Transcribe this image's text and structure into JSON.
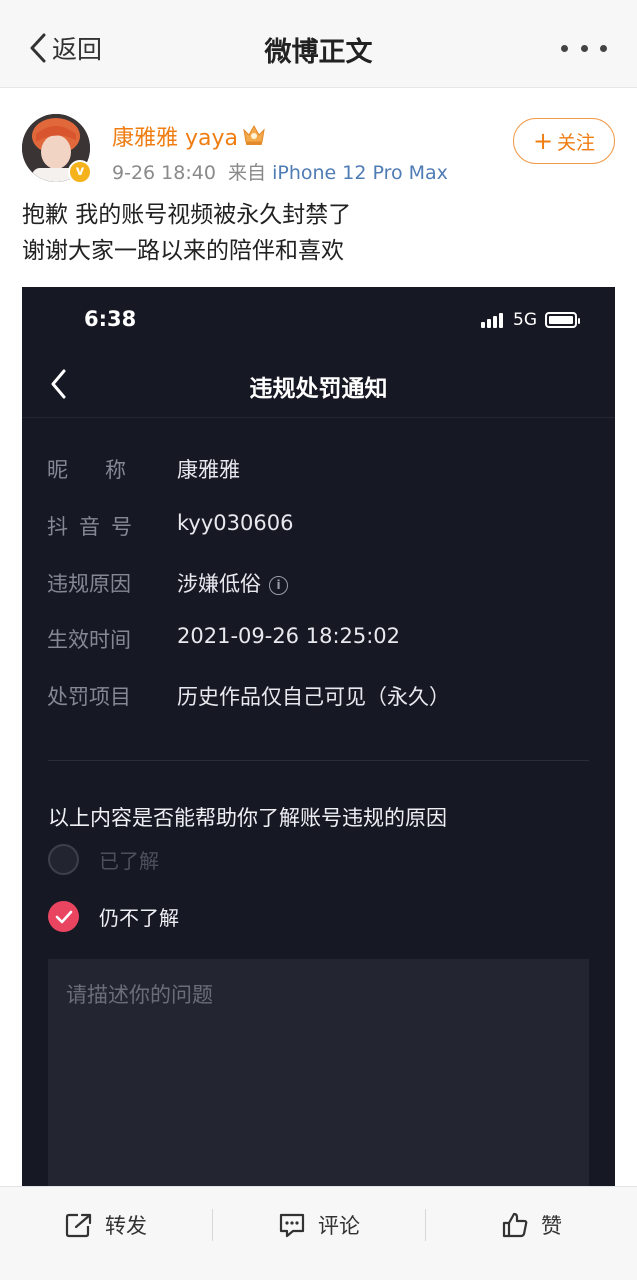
{
  "nav": {
    "back_label": "返回",
    "title": "微博正文"
  },
  "post": {
    "author": "康雅雅 yaya",
    "time": "9-26 18:40",
    "source_prefix": "来自",
    "source": "iPhone 12 Pro Max",
    "follow_label": "关注",
    "text_line1": "抱歉 我的账号视频被永久封禁了",
    "text_line2": "谢谢大家一路以来的陪伴和喜欢"
  },
  "screenshot": {
    "time": "6:38",
    "network": "5G",
    "title": "违规处罚通知",
    "rows": [
      {
        "label": "昵称",
        "value": "康雅雅"
      },
      {
        "label": "抖音号",
        "value": "kyy030606"
      },
      {
        "label": "违规原因",
        "value": "涉嫌低俗"
      },
      {
        "label": "生效时间",
        "value": "2021-09-26 18:25:02"
      },
      {
        "label": "处罚项目",
        "value": "历史作品仅自己可见（永久）"
      }
    ],
    "question": "以上内容是否能帮助你了解账号违规的原因",
    "options": [
      {
        "label": "已了解",
        "selected": false
      },
      {
        "label": "仍不了解",
        "selected": true
      }
    ],
    "textarea_placeholder": "请描述你的问题",
    "accent_color": "#e94560"
  },
  "actions": {
    "repost": "转发",
    "comment": "评论",
    "like": "赞"
  },
  "colors": {
    "username": "#f07d12",
    "source_link": "#4f7cb5",
    "dark_bg": "#161824"
  }
}
